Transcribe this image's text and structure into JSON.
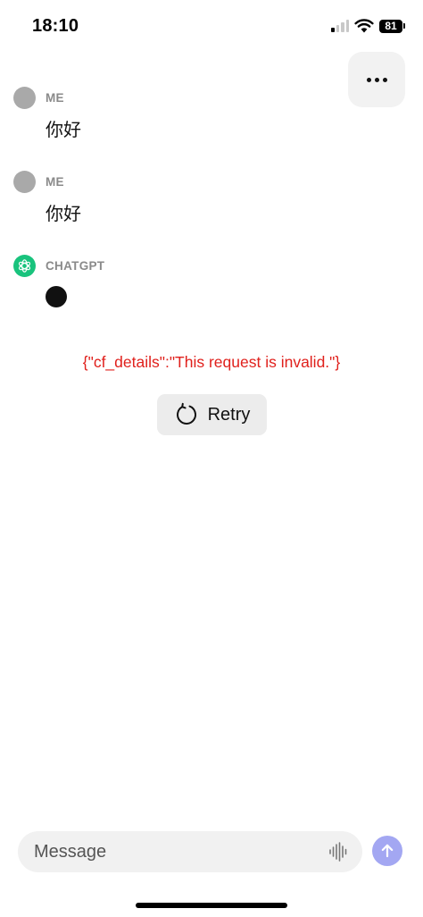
{
  "status_bar": {
    "time": "18:10",
    "battery": "81",
    "signal_icon": "cellular-signal-icon",
    "wifi_icon": "wifi-icon"
  },
  "header": {
    "more_icon": "ellipsis-icon"
  },
  "messages": [
    {
      "author": "ME",
      "text": "你好",
      "avatar": "user-avatar"
    },
    {
      "author": "ME",
      "text": "你好",
      "avatar": "user-avatar"
    },
    {
      "author": "CHATGPT",
      "text": "",
      "avatar": "chatgpt-logo-icon",
      "state": "typing"
    }
  ],
  "error": {
    "text": "{\"cf_details\":\"This request is invalid.\"}",
    "color": "#e0201c"
  },
  "retry": {
    "label": "Retry",
    "icon": "refresh-icon"
  },
  "composer": {
    "placeholder": "Message",
    "value": "",
    "voice_icon": "audio-waveform-icon",
    "send_icon": "arrow-up-icon"
  },
  "colors": {
    "chatgpt_green": "#19c37d",
    "send_button": "#a3a7f2",
    "avatar_grey": "#a9a9a9"
  }
}
